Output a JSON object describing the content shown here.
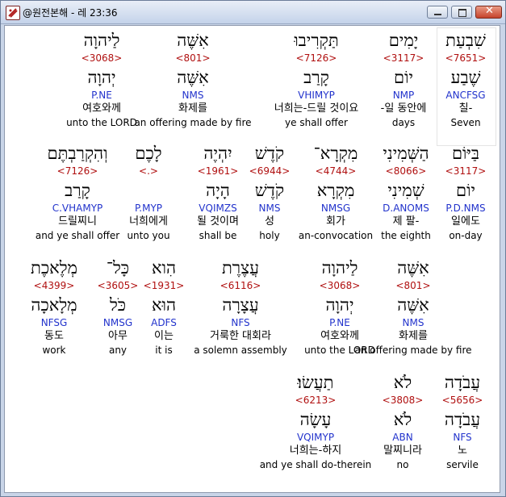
{
  "window": {
    "title": "@원전본해 - 레 23:36",
    "buttons": {
      "minimize": "minimize",
      "maximize": "maximize",
      "close": "✕"
    }
  },
  "rows": [
    [
      {
        "heb": "שִׁבְעַת",
        "strong": "<7651>",
        "root": "שֶׁבַע",
        "morph": "ANCFSG",
        "kor": "칠-",
        "eng": "Seven"
      },
      {
        "heb": "יָמִים",
        "strong": "<3117>",
        "root": "יוֹם",
        "morph": "NMP",
        "kor": "-일 동안에",
        "eng": "days"
      },
      {
        "heb": "תַּקְרִיבוּ",
        "strong": "<7126>",
        "root": "קָרַב",
        "morph": "VHIMYP",
        "kor": "너희는-드릴 것이요",
        "eng": "ye shall offer"
      },
      {
        "heb": "אִשֶּׁה",
        "strong": "<801>",
        "root": "אִשֶּׁה",
        "morph": "NMS",
        "kor": "화제를",
        "eng": "an offering made by fire"
      },
      {
        "heb": "לַיהוָה",
        "strong": "<3068>",
        "root": "יְהוָה",
        "morph": "P.NE",
        "kor": "여호와께",
        "eng": "unto the LORD"
      }
    ],
    [
      {
        "heb": "בַּיּוֹם",
        "strong": "<3117>",
        "root": "יוֹם",
        "morph": "P.D.NMS",
        "kor": "일에도",
        "eng": "on-day"
      },
      {
        "heb": "הַשְּׁמִינִי",
        "strong": "<8066>",
        "root": "שְׁמִינִי",
        "morph": "D.ANOMS",
        "kor": "제 팔-",
        "eng": "the eighth"
      },
      {
        "heb": "מִקְרָא־",
        "strong": "<4744>",
        "root": "מִקְרָא",
        "morph": "NMSG",
        "kor": "회가",
        "eng": "an-convocation"
      },
      {
        "heb": "קֹדֶשׁ",
        "strong": "<6944>",
        "root": "קֹדֶשׁ",
        "morph": "NMS",
        "kor": "성",
        "eng": "holy"
      },
      {
        "heb": "יִהְיֶה",
        "strong": "<1961>",
        "root": "הָיָה",
        "morph": "VQIMZS",
        "kor": "될 것이며",
        "eng": "shall be"
      },
      {
        "heb": "לָכֶם",
        "strong": "<.>",
        "root": "",
        "morph": "P.MYP",
        "kor": "너희에게",
        "eng": "unto you"
      },
      {
        "heb": "וְהִקְרַבְתֶּם",
        "strong": "<7126>",
        "root": "קָרַב",
        "morph": "C.VHAMYP",
        "kor": "드릴찌니",
        "eng": "and ye shall offer"
      }
    ],
    [
      {
        "heb": "אִשֶּׁה",
        "strong": "<801>",
        "root": "אִשֶּׁה",
        "morph": "NMS",
        "kor": "화제를",
        "eng": "an offering made by fire"
      },
      {
        "heb": "לַיהוָה",
        "strong": "<3068>",
        "root": "יְהוָה",
        "morph": "P.NE",
        "kor": "여호와께",
        "eng": "unto the LORD"
      },
      {
        "heb": "עֲצֶרֶת",
        "strong": "<6116>",
        "root": "עֲצָרָה",
        "morph": "NFS",
        "kor": "거룩한 대회라",
        "eng": "a solemn assembly"
      },
      {
        "heb": "הִוא",
        "strong": "<1931>",
        "root": "הוּא",
        "morph": "ADFS",
        "kor": "이는",
        "eng": "it is"
      },
      {
        "heb": "כָּל־",
        "strong": "<3605>",
        "root": "כֹּל",
        "morph": "NMSG",
        "kor": "아무",
        "eng": "any"
      },
      {
        "heb": "מְלֶאכֶת",
        "strong": "<4399>",
        "root": "מְלָאכָה",
        "morph": "NFSG",
        "kor": "동도",
        "eng": "work"
      }
    ],
    [
      {
        "heb": "עֲבֹדָה",
        "strong": "<5656>",
        "root": "עֲבֹדָה",
        "morph": "NFS",
        "kor": "노",
        "eng": "servile"
      },
      {
        "heb": "לֹא",
        "strong": "<3808>",
        "root": "לֹא",
        "morph": "ABN",
        "kor": "말찌니라",
        "eng": "no"
      },
      {
        "heb": "תַעֲשׂוּ׃",
        "strong": "<6213>",
        "root": "עָשָׂה",
        "morph": "VQIMYP",
        "kor": "너희는-하지",
        "eng": "and ye shall do-therein"
      }
    ]
  ]
}
